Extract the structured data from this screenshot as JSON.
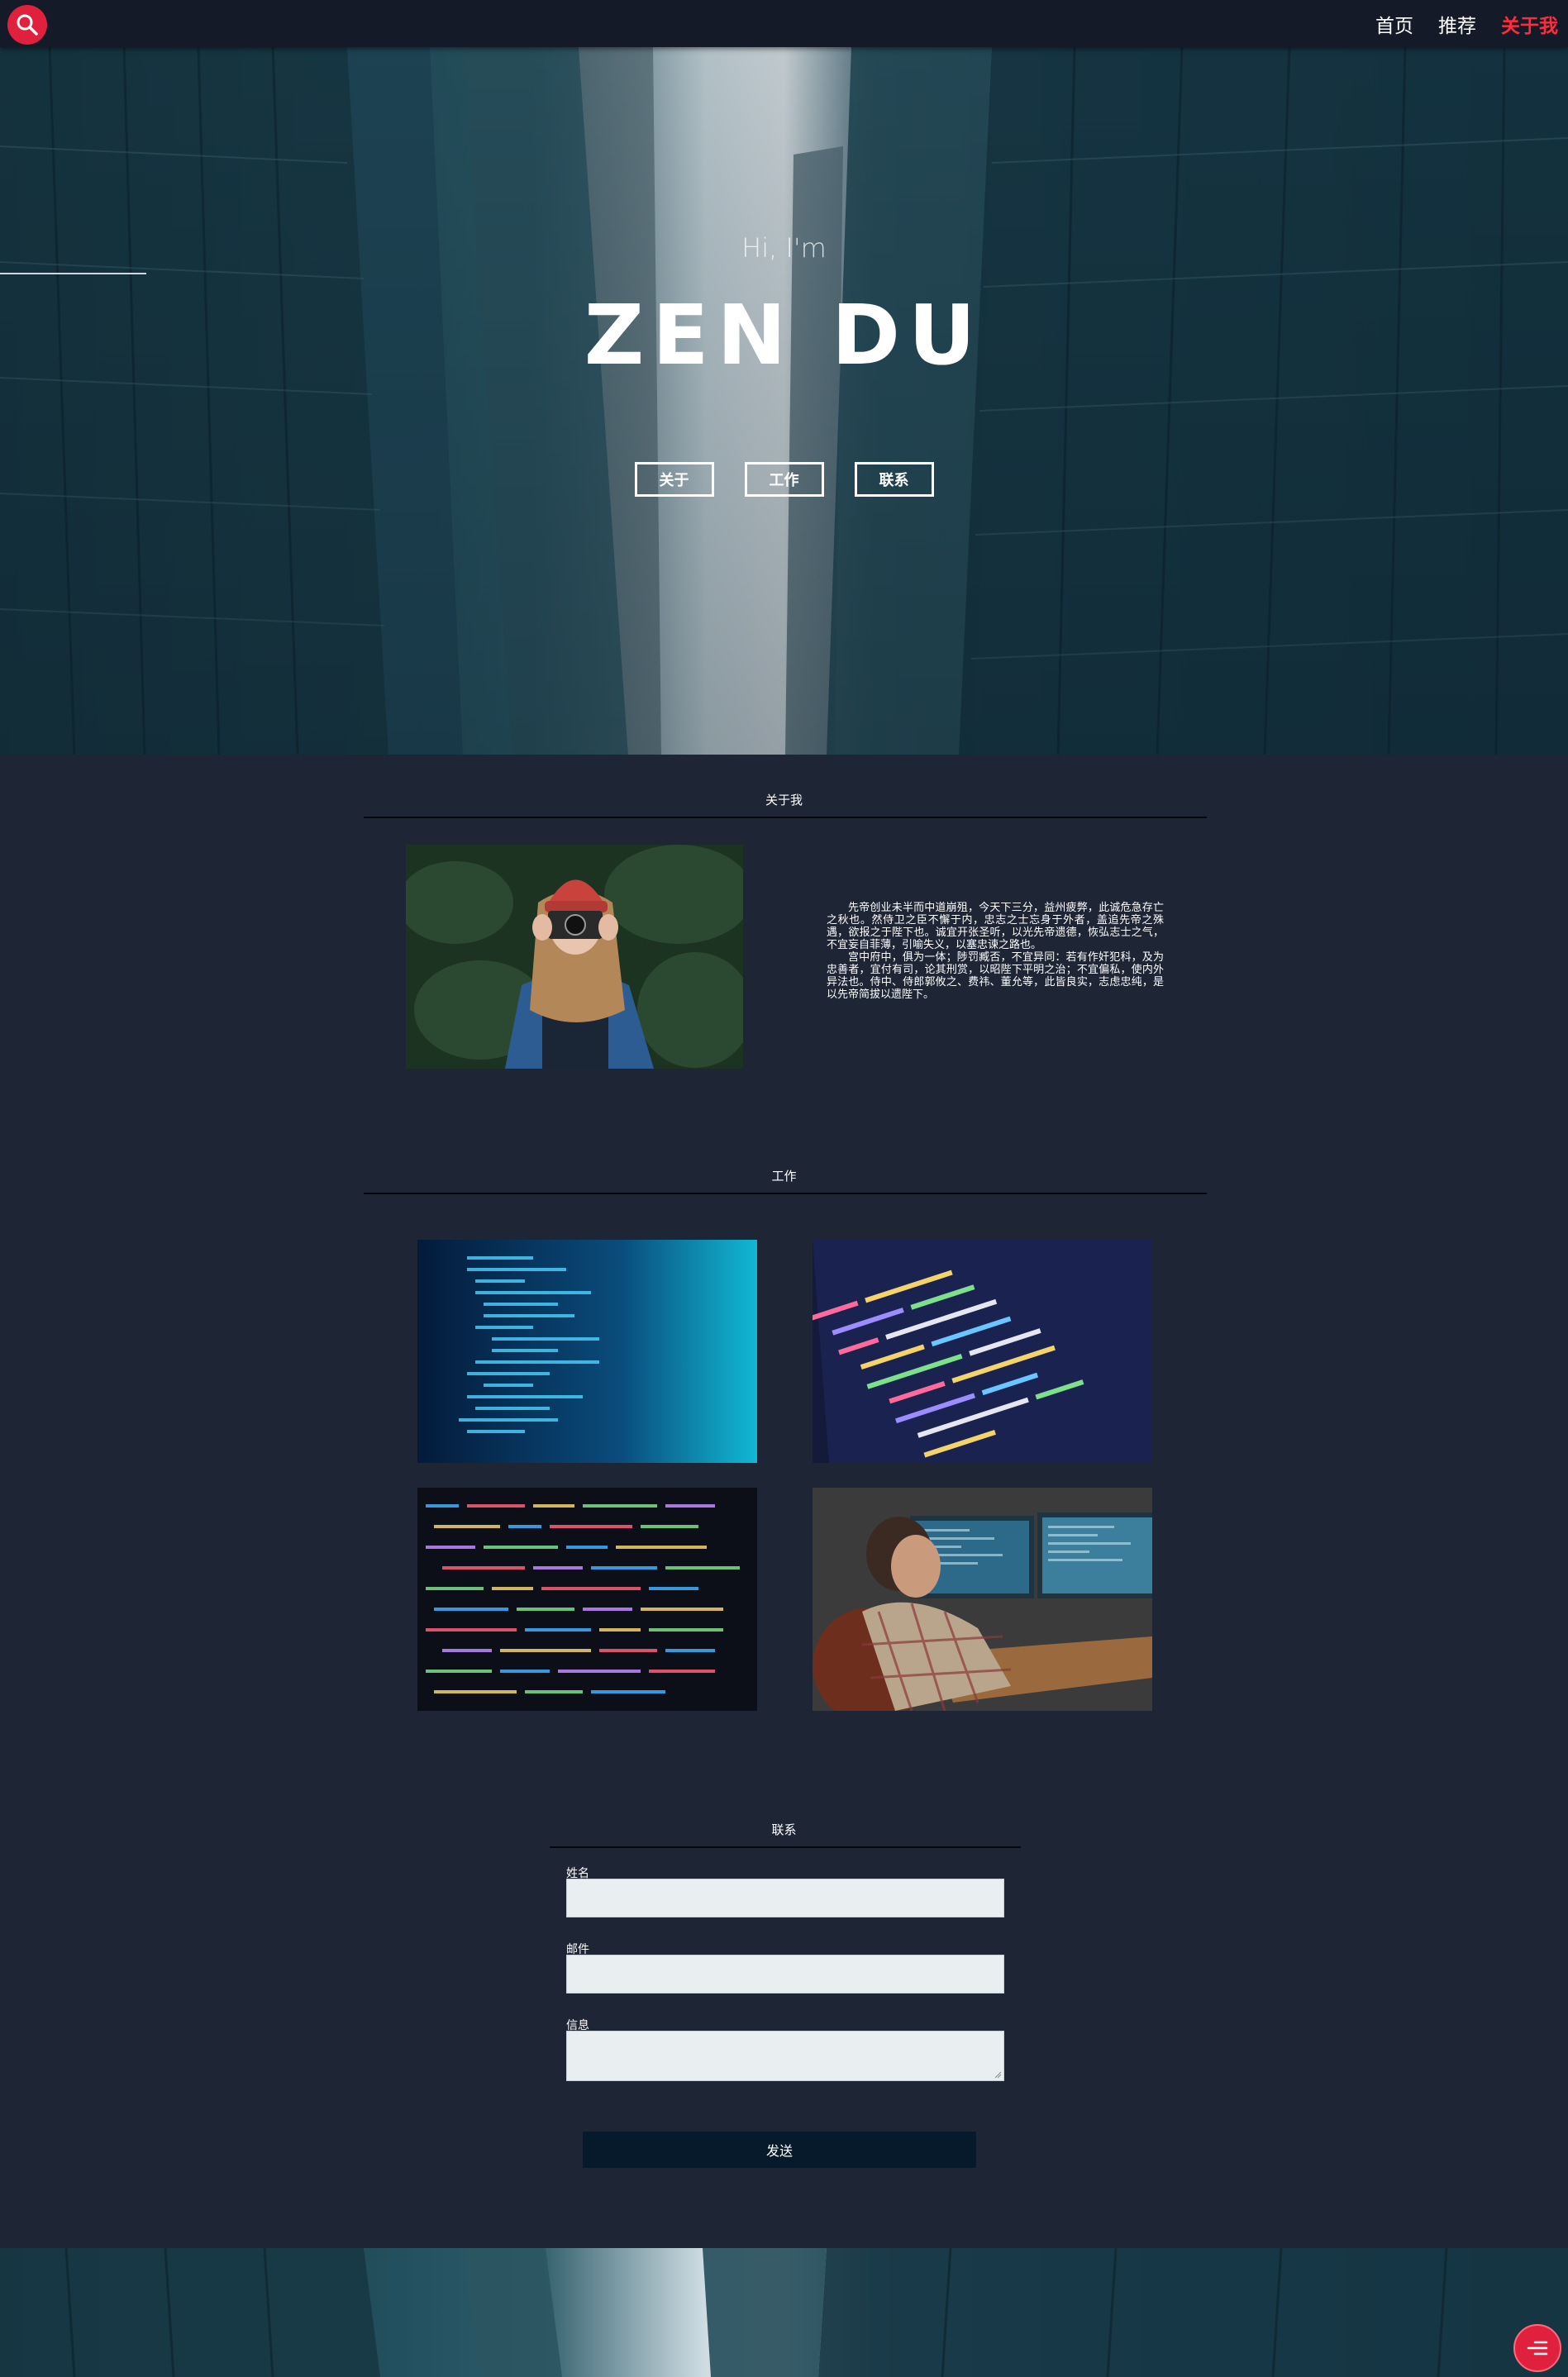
{
  "nav": {
    "items": [
      {
        "label": "首页",
        "active": false
      },
      {
        "label": "推荐",
        "active": false
      },
      {
        "label": "关于我",
        "active": true
      }
    ],
    "search_icon": "search-icon",
    "accent_color": "#e0213e"
  },
  "hero": {
    "greeting": "Hi, I'm",
    "name": "ZEN DU",
    "buttons": [
      "关于",
      "工作",
      "联系"
    ]
  },
  "about": {
    "title": "关于我",
    "paragraphs": [
      "先帝创业未半而中道崩殂，今天下三分，益州疲弊，此诚危急存亡之秋也。然侍卫之臣不懈于内，忠志之士忘身于外者，盖追先帝之殊遇，欲报之于陛下也。诚宜开张圣听，以光先帝遗德，恢弘志士之气，不宜妄自菲薄，引喻失义，以塞忠谏之路也。",
      "宫中府中，俱为一体；陟罚臧否，不宜异同：若有作奸犯科，及为忠善者，宜付有司，论其刑赏，以昭陛下平明之治；不宜偏私，使内外异法也。侍中、侍郎郭攸之、费祎、董允等，此皆良实，志虑忠纯，是以先帝简拔以遗陛下。"
    ]
  },
  "work": {
    "title": "工作"
  },
  "contact": {
    "title": "联系",
    "name_label": "姓名",
    "email_label": "邮件",
    "message_label": "信息",
    "send_label": "发送"
  },
  "floating_menu": {
    "icon": "menu-icon"
  }
}
